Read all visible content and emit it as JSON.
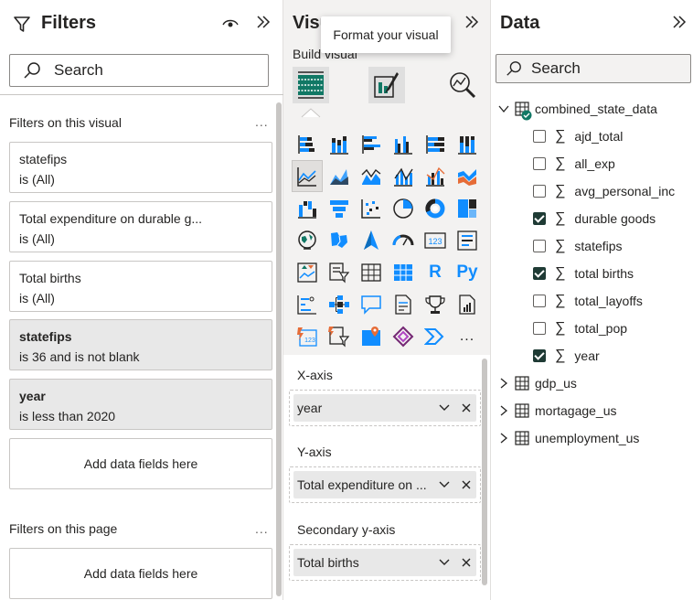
{
  "filters": {
    "title": "Filters",
    "search_placeholder": "Search",
    "on_visual_label": "Filters on this visual",
    "more": "...",
    "cards": [
      {
        "name": "statefips",
        "state": "is (All)"
      },
      {
        "name": "Total expenditure on durable g...",
        "state": "is (All)"
      },
      {
        "name": "Total births",
        "state": "is (All)"
      },
      {
        "name": "statefips",
        "state": "is 36 and is not blank"
      },
      {
        "name": "year",
        "state": "is less than 2020"
      }
    ],
    "add_fields": "Add data fields here",
    "on_page_label": "Filters on this page",
    "page_add_fields": "Add data fields here"
  },
  "viz": {
    "title": "Visu",
    "tooltip": "Format your visual",
    "build_label": "Build visual",
    "wells": [
      {
        "label": "X-axis",
        "field": "year"
      },
      {
        "label": "Y-axis",
        "field": "Total expenditure on ..."
      },
      {
        "label": "Secondary y-axis",
        "field": "Total births"
      }
    ],
    "gallery_text": {
      "r": "R",
      "py": "Py",
      "card_num": "123",
      "more": "..."
    }
  },
  "data": {
    "title": "Data",
    "search_placeholder": "Search",
    "table": "combined_state_data",
    "fields": [
      {
        "name": "ajd_total",
        "checked": false
      },
      {
        "name": "all_exp",
        "checked": false
      },
      {
        "name": "avg_personal_inc",
        "checked": false
      },
      {
        "name": "durable goods",
        "checked": true
      },
      {
        "name": "statefips",
        "checked": false
      },
      {
        "name": "total births",
        "checked": true
      },
      {
        "name": "total_layoffs",
        "checked": false
      },
      {
        "name": "total_pop",
        "checked": false
      },
      {
        "name": "year",
        "checked": true
      }
    ],
    "other_tables": [
      "gdp_us",
      "mortagage_us",
      "unemployment_us"
    ]
  },
  "colors": {
    "accent": "#118dff",
    "checked": "#1f3b35",
    "teal": "#117865",
    "orange": "#e66c37"
  }
}
